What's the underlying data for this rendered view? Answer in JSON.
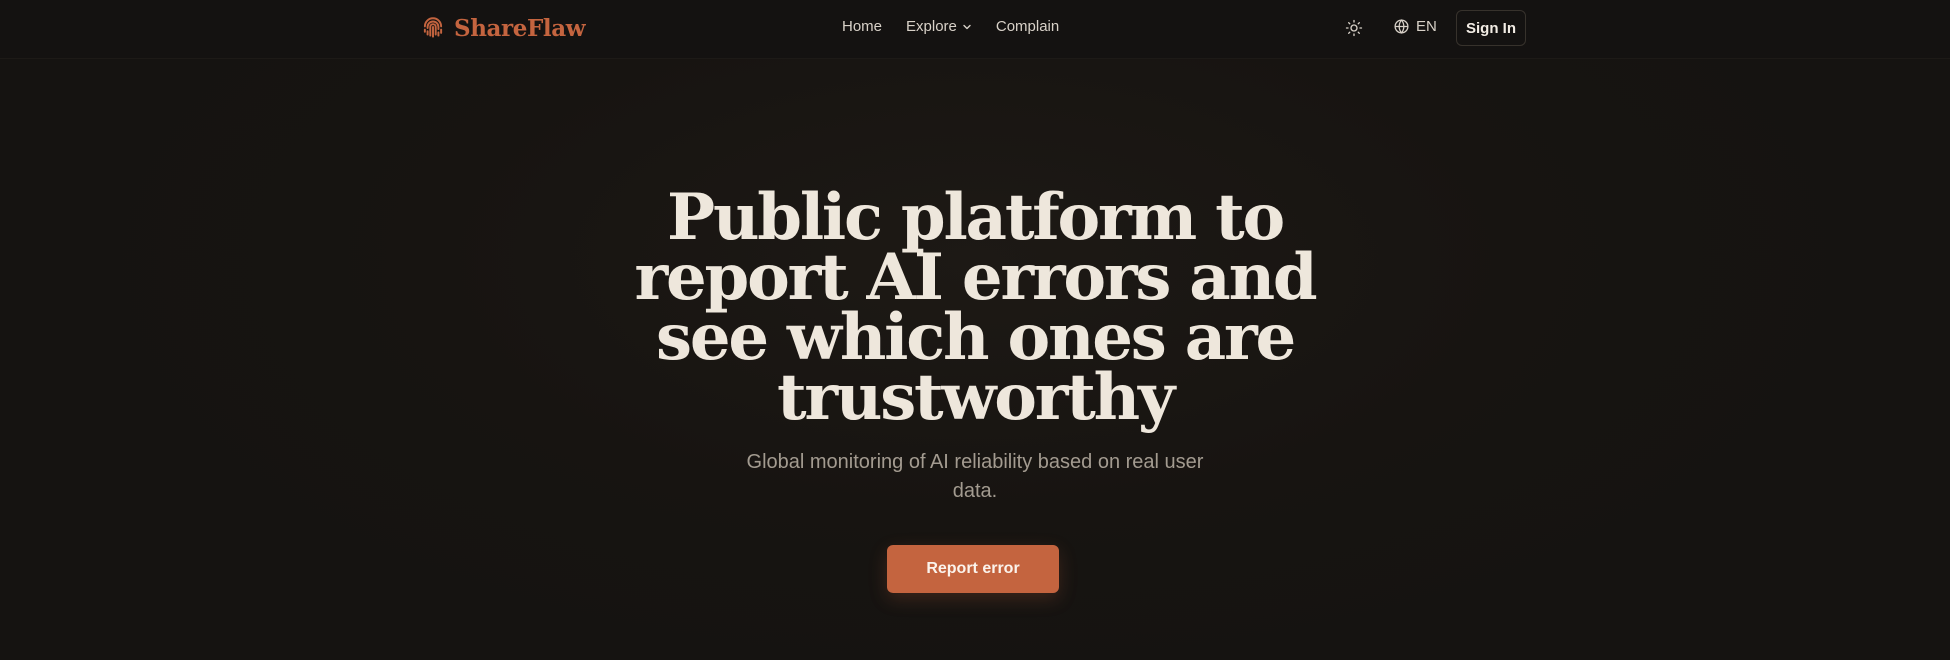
{
  "brand": {
    "name": "ShareFlaw",
    "icon": "fingerprint-icon",
    "color": "#c4643f"
  },
  "nav": {
    "items": [
      {
        "label": "Home"
      },
      {
        "label": "Explore",
        "icon": "chevron-down-icon"
      },
      {
        "label": "Complain"
      }
    ]
  },
  "header_actions": {
    "theme_icon": "sun-icon",
    "language": {
      "icon": "globe-icon",
      "label": "EN"
    },
    "sign_in_label": "Sign In"
  },
  "hero": {
    "title": "Public platform to report AI errors and see which ones are trustworthy",
    "subtitle": "Global monitoring of AI reliability based on real user data.",
    "cta_label": "Report error"
  },
  "colors": {
    "background": "#151311",
    "accent": "#c4643f",
    "title_text": "#eee7dc",
    "muted_text": "#a39b90"
  }
}
